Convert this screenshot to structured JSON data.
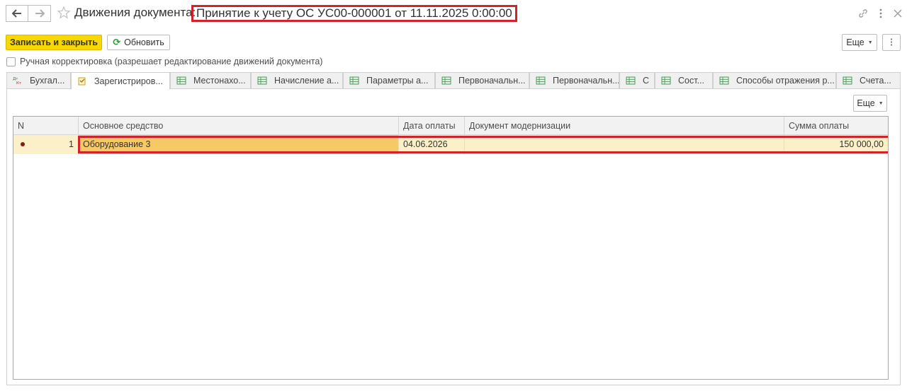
{
  "header": {
    "title_prefix": "Движения документа:",
    "title_document": "Принятие к учету ОС УС00-000001 от 11.11.2025 0:00:00",
    "icons": [
      "arrow-left-icon",
      "arrow-right-icon",
      "star-icon",
      "link-icon",
      "kebab-menu-icon",
      "close-icon"
    ]
  },
  "toolbar": {
    "save_close_label": "Записать и закрыть",
    "refresh_label": "Обновить",
    "more_label": "Еще",
    "options_glyph": "⁝"
  },
  "manual_correction": {
    "checked": false,
    "label": "Ручная корректировка (разрешает редактирование движений документа)"
  },
  "tabs": [
    {
      "label": "Бухгал...",
      "icon": "dt-kt-icon",
      "active": false
    },
    {
      "label": "Зарегистриров...",
      "icon": "register-doc-icon",
      "active": true
    },
    {
      "label": "Местонахо...",
      "icon": "table-icon",
      "active": false
    },
    {
      "label": "Начисление а...",
      "icon": "table-icon",
      "active": false
    },
    {
      "label": "Параметры а...",
      "icon": "table-icon",
      "active": false
    },
    {
      "label": "Первоначальн...",
      "icon": "table-icon",
      "active": false
    },
    {
      "label": "Первоначальн...",
      "icon": "table-icon",
      "active": false
    },
    {
      "label": "С",
      "icon": "table-icon",
      "active": false
    },
    {
      "label": "Сост...",
      "icon": "table-icon",
      "active": false
    },
    {
      "label": "Способы отражения р...",
      "icon": "table-icon",
      "active": false
    },
    {
      "label": "Счета...",
      "icon": "table-icon",
      "active": false
    }
  ],
  "grid": {
    "more_label": "Еще",
    "columns": [
      "N",
      "Основное средство",
      "Дата оплаты",
      "Документ модернизации",
      "Сумма оплаты"
    ],
    "rows": [
      {
        "n": "1",
        "asset": "Оборудование 3",
        "pay_date": "04.06.2026",
        "modernization_doc": "",
        "amount": "150 000,00"
      }
    ]
  },
  "colors": {
    "accent_button": "#f9d700",
    "highlight_frame": "#d0232a",
    "row_selected": "#fbf0c7",
    "cell_current": "#f6c866"
  }
}
